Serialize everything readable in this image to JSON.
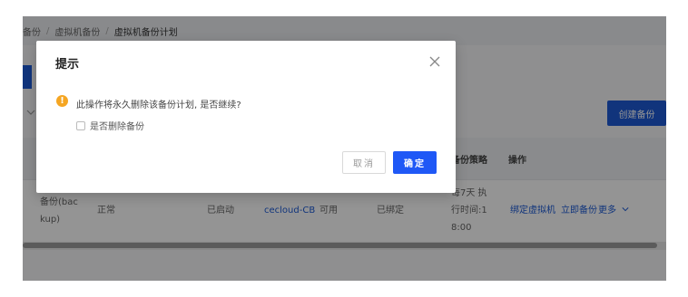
{
  "breadcrumb": {
    "items": [
      "备份",
      "虚拟机备份",
      "虚拟机备份计划"
    ],
    "separator": "/"
  },
  "toolbar": {
    "create_backup_label": "创建备份"
  },
  "search": {
    "toggle_icon": "chevron-down-icon"
  },
  "table": {
    "headers": {
      "backup_policy": "备份策略",
      "actions": "操作"
    },
    "rows": [
      {
        "name_line1": "备份(bac",
        "name_line2": "kup)",
        "status": "正常",
        "enabled": "已启动",
        "storage": "cecloud-CB",
        "availability": "可用",
        "binding": "已绑定",
        "policy_line1": "每7天 执",
        "policy_line2": "行时间:1",
        "policy_line3": "8:00",
        "actions": {
          "bind_vm": "绑定虚拟机",
          "backup_now": "立即备份",
          "more": "更多"
        }
      }
    ]
  },
  "dialog": {
    "title": "提示",
    "message": "此操作将永久删除该备份计划, 是否继续?",
    "checkbox_label": "是否删除备份",
    "checkbox_checked": false,
    "cancel_label": "取消",
    "confirm_label": "确定",
    "warning_glyph": "!",
    "close_icon": "close-icon"
  },
  "colors": {
    "primary": "#1f58f6",
    "link": "#1d5bd6",
    "warning": "#f5a623"
  }
}
